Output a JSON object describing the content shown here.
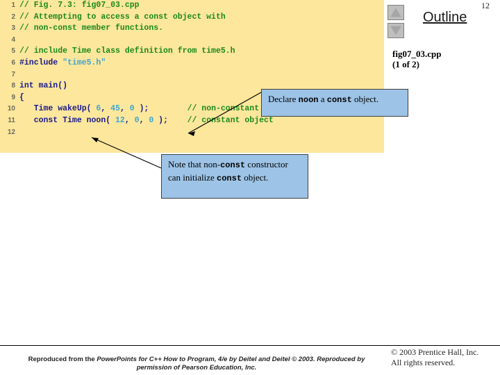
{
  "slide": {
    "number": "12",
    "outline_title": "Outline",
    "file_name": "fig07_03.cpp",
    "file_part": "(1 of 2)",
    "nav_up_icon": "triangle-up-icon",
    "nav_down_icon": "triangle-down-icon"
  },
  "code": {
    "language": "cpp",
    "background_color": "#fde79c",
    "comment_color": "#1a8a1a",
    "keyword_color": "#1a1a8c",
    "literal_color": "#3aa7d4",
    "linenumber_color": "#6b6b58",
    "lines": [
      {
        "no": "1",
        "segments": [
          {
            "t": "// Fig. 7.3: fig07_03.cpp",
            "c": "comment"
          }
        ]
      },
      {
        "no": "2",
        "segments": [
          {
            "t": "// Attempting to access a const object with",
            "c": "comment"
          }
        ]
      },
      {
        "no": "3",
        "segments": [
          {
            "t": "// non-const member functions.",
            "c": "comment"
          }
        ]
      },
      {
        "no": "4",
        "segments": []
      },
      {
        "no": "5",
        "segments": [
          {
            "t": "// include Time class definition from time5.h",
            "c": "comment"
          }
        ]
      },
      {
        "no": "6",
        "segments": [
          {
            "t": "#include",
            "c": "pre"
          },
          {
            "t": " ",
            "c": "plain"
          },
          {
            "t": "\"time5.h\"",
            "c": "str"
          }
        ]
      },
      {
        "no": "7",
        "segments": []
      },
      {
        "no": "8",
        "segments": [
          {
            "t": "int main()",
            "c": "keyword"
          }
        ]
      },
      {
        "no": "9",
        "segments": [
          {
            "t": "{",
            "c": "plain"
          }
        ]
      },
      {
        "no": "10",
        "segments": [
          {
            "t": "   Time wakeUp( ",
            "c": "plain"
          },
          {
            "t": "6",
            "c": "num"
          },
          {
            "t": ", ",
            "c": "plain"
          },
          {
            "t": "45",
            "c": "num"
          },
          {
            "t": ", ",
            "c": "plain"
          },
          {
            "t": "0",
            "c": "num"
          },
          {
            "t": " );        ",
            "c": "plain"
          },
          {
            "t": "// non-constant object",
            "c": "comment"
          }
        ]
      },
      {
        "no": "11",
        "segments": [
          {
            "t": "   const Time noon( ",
            "c": "plain"
          },
          {
            "t": "12",
            "c": "num"
          },
          {
            "t": ", ",
            "c": "plain"
          },
          {
            "t": "0",
            "c": "num"
          },
          {
            "t": ", ",
            "c": "plain"
          },
          {
            "t": "0",
            "c": "num"
          },
          {
            "t": " );    ",
            "c": "plain"
          },
          {
            "t": "// constant object",
            "c": "comment"
          }
        ]
      },
      {
        "no": "12",
        "segments": []
      }
    ]
  },
  "callouts": [
    {
      "id": "callout-declare",
      "background_color": "#9dc3e6",
      "parts": [
        {
          "t": "Declare ",
          "style": "normal"
        },
        {
          "t": "noon",
          "style": "mono"
        },
        {
          "t": " a ",
          "style": "normal"
        },
        {
          "t": "const",
          "style": "mono"
        },
        {
          "t": " object.",
          "style": "normal"
        }
      ]
    },
    {
      "id": "callout-note",
      "background_color": "#9dc3e6",
      "parts": [
        {
          "t": "Note that non-",
          "style": "normal"
        },
        {
          "t": "const",
          "style": "mono"
        },
        {
          "t": " constructor can initialize ",
          "style": "normal"
        },
        {
          "t": "const",
          "style": "mono"
        },
        {
          "t": " object.",
          "style": "normal"
        }
      ]
    }
  ],
  "footer": {
    "credit_line1_a": "Reproduced from the ",
    "credit_line1_b": "PowerPoints for C++ How to Program, 4/e by Deitel and Deitel © 2003. Reproduced by",
    "credit_line2": "permission of Pearson Education, Inc.",
    "copyright_line1": "© 2003 Prentice Hall, Inc.",
    "copyright_line2": "All rights reserved."
  }
}
